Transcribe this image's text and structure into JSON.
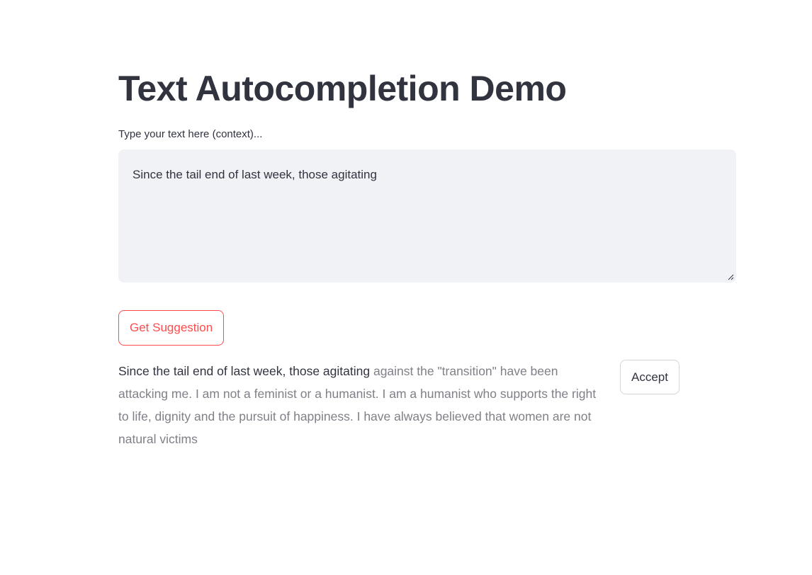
{
  "page": {
    "title": "Text Autocompletion Demo"
  },
  "input": {
    "label": "Type your text here (context)...",
    "value": "Since the tail end of last week, those agitating"
  },
  "buttons": {
    "get_suggestion": "Get Suggestion",
    "accept": "Accept"
  },
  "result": {
    "context_text": "Since the tail end of last week, those agitating",
    "suggestion_text": " against the \"transition\" have been attacking me. I am not a feminist or a humanist. I am a humanist who supports the right to life, dignity and the pursuit of happiness. I have always believed that women are not natural victims"
  },
  "colors": {
    "text": "#31333f",
    "accent": "#ff4b4b",
    "suggestion": "#7f8088",
    "input_bg": "#f0f2f6"
  }
}
